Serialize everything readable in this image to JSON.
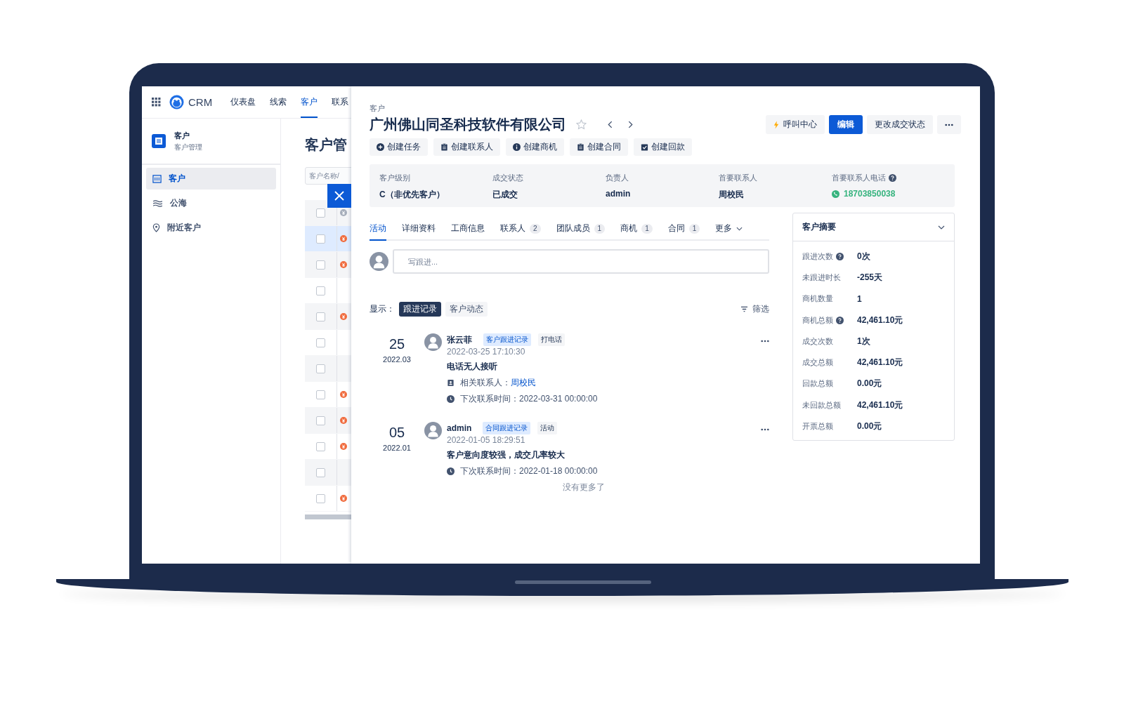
{
  "nav": {
    "brand": "CRM",
    "items": [
      {
        "label": "仪表盘",
        "selected": false
      },
      {
        "label": "线索",
        "selected": false
      },
      {
        "label": "客户",
        "selected": true
      },
      {
        "label": "联系",
        "selected": false
      }
    ]
  },
  "sidebar": {
    "title": "客户",
    "subtitle": "客户管理",
    "items": [
      {
        "label": "客户",
        "kind": "building",
        "selected": true
      },
      {
        "label": "公海",
        "kind": "waves",
        "selected": false
      },
      {
        "label": "附近客户",
        "kind": "pin",
        "selected": false
      }
    ]
  },
  "list": {
    "title": "客户管",
    "search_placeholder": "客户名称/",
    "rows": [
      {
        "checked": false,
        "selected": false,
        "color": "#a5adba"
      },
      {
        "checked": false,
        "selected": true,
        "color": "#f06a3c"
      },
      {
        "checked": false,
        "selected": false,
        "color": "#f06a3c"
      },
      {
        "checked": false,
        "selected": false
      },
      {
        "checked": false,
        "selected": false,
        "color": "#f06a3c"
      },
      {
        "checked": false,
        "selected": false
      },
      {
        "checked": false,
        "selected": false
      },
      {
        "checked": false,
        "selected": false,
        "color": "#f06a3c"
      },
      {
        "checked": false,
        "selected": false,
        "color": "#f06a3c"
      },
      {
        "checked": false,
        "selected": false,
        "color": "#f06a3c"
      },
      {
        "checked": false,
        "selected": false
      },
      {
        "checked": false,
        "selected": false,
        "color": "#f06a3c"
      }
    ]
  },
  "drawer": {
    "breadcrumb": "客户",
    "title": "广州佛山同圣科技软件有限公司",
    "starred": false,
    "header_buttons": [
      {
        "label": "呼叫中心",
        "kind": "call"
      },
      {
        "label": "编辑",
        "kind": "primary"
      },
      {
        "label": "更改成交状态",
        "kind": "default"
      },
      {
        "kind": "more"
      }
    ],
    "actions": [
      {
        "label": "创建任务",
        "kind": "plus"
      },
      {
        "label": "创建联系人",
        "kind": "clipboard"
      },
      {
        "label": "创建商机",
        "kind": "info"
      },
      {
        "label": "创建合同",
        "kind": "clipboard"
      },
      {
        "label": "创建回款",
        "kind": "check"
      }
    ],
    "info": [
      {
        "label": "客户级别",
        "value": "C（非优先客户）",
        "help": false,
        "kind": "text"
      },
      {
        "label": "成交状态",
        "value": "已成交",
        "help": false,
        "kind": "text"
      },
      {
        "label": "负责人",
        "value": "admin",
        "help": false,
        "kind": "text"
      },
      {
        "label": "首要联系人",
        "value": "周校民",
        "help": false,
        "kind": "text"
      },
      {
        "label": "首要联系人电话",
        "value": "18703850038",
        "help": true,
        "kind": "phone"
      }
    ],
    "tabs": [
      {
        "label": "活动",
        "selected": true
      },
      {
        "label": "详细资料",
        "selected": false
      },
      {
        "label": "工商信息",
        "selected": false
      },
      {
        "label": "联系人",
        "count": "2",
        "selected": false
      },
      {
        "label": "团队成员",
        "count": "1",
        "selected": false
      },
      {
        "label": "商机",
        "count": "1",
        "selected": false
      },
      {
        "label": "合同",
        "count": "1",
        "selected": false
      },
      {
        "label": "更多",
        "kind": "dropdown",
        "selected": false
      }
    ],
    "composer": {
      "placeholder": "写跟进..."
    },
    "display": {
      "label": "显示：",
      "options": [
        {
          "label": "跟进记录",
          "selected": true
        },
        {
          "label": "客户动态",
          "selected": false
        }
      ],
      "filter": "筛选"
    },
    "records": [
      {
        "day": "25",
        "month": "2022.03",
        "author": "张云菲",
        "type_tag": "客户跟进记录",
        "method_tag": "打电话",
        "time": "2022-03-25 17:10:30",
        "content": "电话无人接听",
        "contact_label": "相关联系人：",
        "contact": "周校民",
        "next_contact": "下次联系时间：2022-03-31 00:00:00"
      },
      {
        "day": "05",
        "month": "2022.01",
        "author": "admin",
        "type_tag": "合同跟进记录",
        "method_tag": "活动",
        "time": "2022-01-05 18:29:51",
        "content": "客户意向度较强，成交几率较大",
        "next_contact": "下次联系时间：2022-01-18 00:00:00"
      }
    ],
    "end_note": "没有更多了",
    "summary": {
      "title": "客户摘要",
      "expanded": true,
      "rows": [
        {
          "label": "跟进次数",
          "value": "0次",
          "help": true
        },
        {
          "label": "未跟进时长",
          "value": "-255天",
          "help": false
        },
        {
          "label": "商机数量",
          "value": "1",
          "help": false
        },
        {
          "label": "商机总额",
          "value": "42,461.10元",
          "help": true
        },
        {
          "label": "成交次数",
          "value": "1次",
          "help": false
        },
        {
          "label": "成交总额",
          "value": "42,461.10元",
          "help": false
        },
        {
          "label": "回款总额",
          "value": "0.00元",
          "help": false
        },
        {
          "label": "未回款总额",
          "value": "42,461.10元",
          "help": false
        },
        {
          "label": "开票总额",
          "value": "0.00元",
          "help": false
        }
      ]
    }
  }
}
